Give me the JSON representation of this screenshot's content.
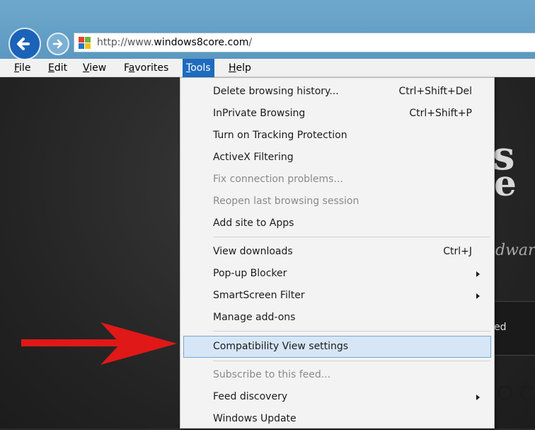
{
  "address_bar": {
    "url_prefix": "http://www.",
    "url_domain": "windows8core.com",
    "url_suffix": "/"
  },
  "menubar": {
    "items": [
      {
        "label": "File",
        "mnemonic": "F",
        "rest": "ile"
      },
      {
        "label": "Edit",
        "mnemonic": "E",
        "rest": "dit"
      },
      {
        "label": "View",
        "mnemonic": "V",
        "rest": "iew"
      },
      {
        "label": "Favorites",
        "mnemonic": "a",
        "pre": "F",
        "rest": "vorites"
      },
      {
        "label": "Tools",
        "mnemonic": "T",
        "rest": "ools"
      },
      {
        "label": "Help",
        "mnemonic": "H",
        "rest": "elp"
      }
    ],
    "active": "Tools"
  },
  "tools_menu": {
    "items": [
      {
        "label": "Delete browsing history...",
        "shortcut": "Ctrl+Shift+Del"
      },
      {
        "label": "InPrivate Browsing",
        "shortcut": "Ctrl+Shift+P"
      },
      {
        "label": "Turn on Tracking Protection"
      },
      {
        "label": "ActiveX Filtering"
      },
      {
        "label": "Fix connection problems...",
        "disabled": true
      },
      {
        "label": "Reopen last browsing session",
        "disabled": true
      },
      {
        "label": "Add site to Apps"
      },
      {
        "label": "View downloads",
        "shortcut": "Ctrl+J"
      },
      {
        "label": "Pop-up Blocker",
        "submenu": true
      },
      {
        "label": "SmartScreen Filter",
        "submenu": true
      },
      {
        "label": "Manage add-ons"
      },
      {
        "label": "Compatibility View settings",
        "selected": true
      },
      {
        "label": "Subscribe to this feed...",
        "disabled": true
      },
      {
        "label": "Feed discovery",
        "submenu": true
      },
      {
        "label": "Windows Update"
      }
    ]
  },
  "page_fragments": {
    "big_letters_1": "s",
    "big_letters_2": "e",
    "italic_text": "dwar",
    "side_text": "ed",
    "bottom_text": "O C"
  },
  "colors": {
    "menu_active": "#1e6bbf",
    "selected_item_bg": "#d6e6f6",
    "arrow_red": "#e01818"
  }
}
